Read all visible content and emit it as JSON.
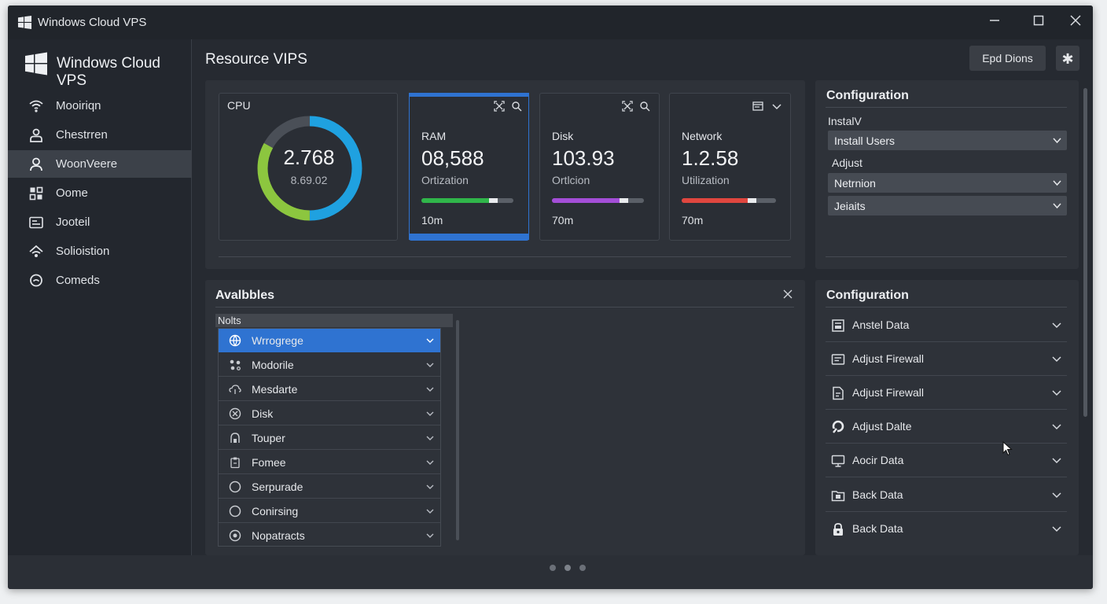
{
  "window": {
    "title": "Windows Cloud VPS",
    "controls": [
      "minimize",
      "maximize",
      "close"
    ]
  },
  "sidebar": {
    "brand": "Windows Cloud VPS",
    "items": [
      {
        "label": "Mooiriqn",
        "icon": "wifi-icon",
        "active": false
      },
      {
        "label": "Chestrren",
        "icon": "users-icon",
        "active": false
      },
      {
        "label": "WoonVeere",
        "icon": "user-icon",
        "active": true
      },
      {
        "label": "Oome",
        "icon": "grid-icon",
        "active": false
      },
      {
        "label": "Jooteil",
        "icon": "card-icon",
        "active": false
      },
      {
        "label": "Solioistion",
        "icon": "network-icon",
        "active": false
      },
      {
        "label": "Comeds",
        "icon": "chat-icon",
        "active": false
      }
    ]
  },
  "header": {
    "title": "Resource VIPS",
    "action_label": "Epd Dions",
    "star_glyph": "✱"
  },
  "resources": {
    "cpu": {
      "label": "CPU",
      "value": "2.768",
      "sub": "8.69.02",
      "ring_colors": [
        "#1fa1e0",
        "#8cc63f",
        "#4a4f57"
      ],
      "ring_fractions": [
        0.5,
        0.33,
        0.17
      ]
    },
    "cards": [
      {
        "label": "RAM",
        "value": "08,588",
        "sub": "Ortization",
        "time": "10m",
        "bar_fraction": 0.83,
        "bar_color": "#30b64a",
        "active": true
      },
      {
        "label": "Disk",
        "value": "103.93",
        "sub": "Ortlcion",
        "time": "70m",
        "bar_fraction": 0.83,
        "bar_color": "#a44ed8",
        "active": false
      },
      {
        "label": "Network",
        "value": "1.2.58",
        "sub": "Utilization",
        "time": "70m",
        "bar_fraction": 0.79,
        "bar_color": "#e0463f",
        "active": false
      }
    ]
  },
  "configuration_top": {
    "title": "Configuration",
    "install_label": "InstalV",
    "install_value": "Install Users",
    "adjust_label": "Adjust",
    "adjust_value_1": "Netrnion",
    "adjust_value_2": "Jeiaits"
  },
  "available": {
    "title": "Avalbbles",
    "list_header": "Nolts",
    "items": [
      {
        "label": "Wrrogrege",
        "icon": "globe-icon",
        "selected": true
      },
      {
        "label": "Modorile",
        "icon": "nodes-icon",
        "selected": false
      },
      {
        "label": "Mesdarte",
        "icon": "cloud-icon",
        "selected": false
      },
      {
        "label": "Disk",
        "icon": "disk-x-icon",
        "selected": false
      },
      {
        "label": "Touper",
        "icon": "lock-icon",
        "selected": false
      },
      {
        "label": "Fomee",
        "icon": "clipboard-icon",
        "selected": false
      },
      {
        "label": "Serpurade",
        "icon": "circle-icon",
        "selected": false
      },
      {
        "label": "Conirsing",
        "icon": "circle-icon",
        "selected": false
      },
      {
        "label": "Nopatracts",
        "icon": "target-icon",
        "selected": false
      }
    ]
  },
  "configuration_bottom": {
    "title": "Configuration",
    "items": [
      {
        "label": "Anstel Data",
        "icon": "database-icon"
      },
      {
        "label": "Adjust Firewall",
        "icon": "firewall-icon"
      },
      {
        "label": "Adjust Firewall",
        "icon": "file-icon"
      },
      {
        "label": "Adjust Dalte",
        "icon": "refresh-icon"
      },
      {
        "label": "Aocir Data",
        "icon": "monitor-icon"
      },
      {
        "label": "Back Data",
        "icon": "folder-icon"
      },
      {
        "label": "Back Data",
        "icon": "lock-data-icon"
      }
    ]
  },
  "pager": {
    "dots": 3,
    "active": 1
  }
}
